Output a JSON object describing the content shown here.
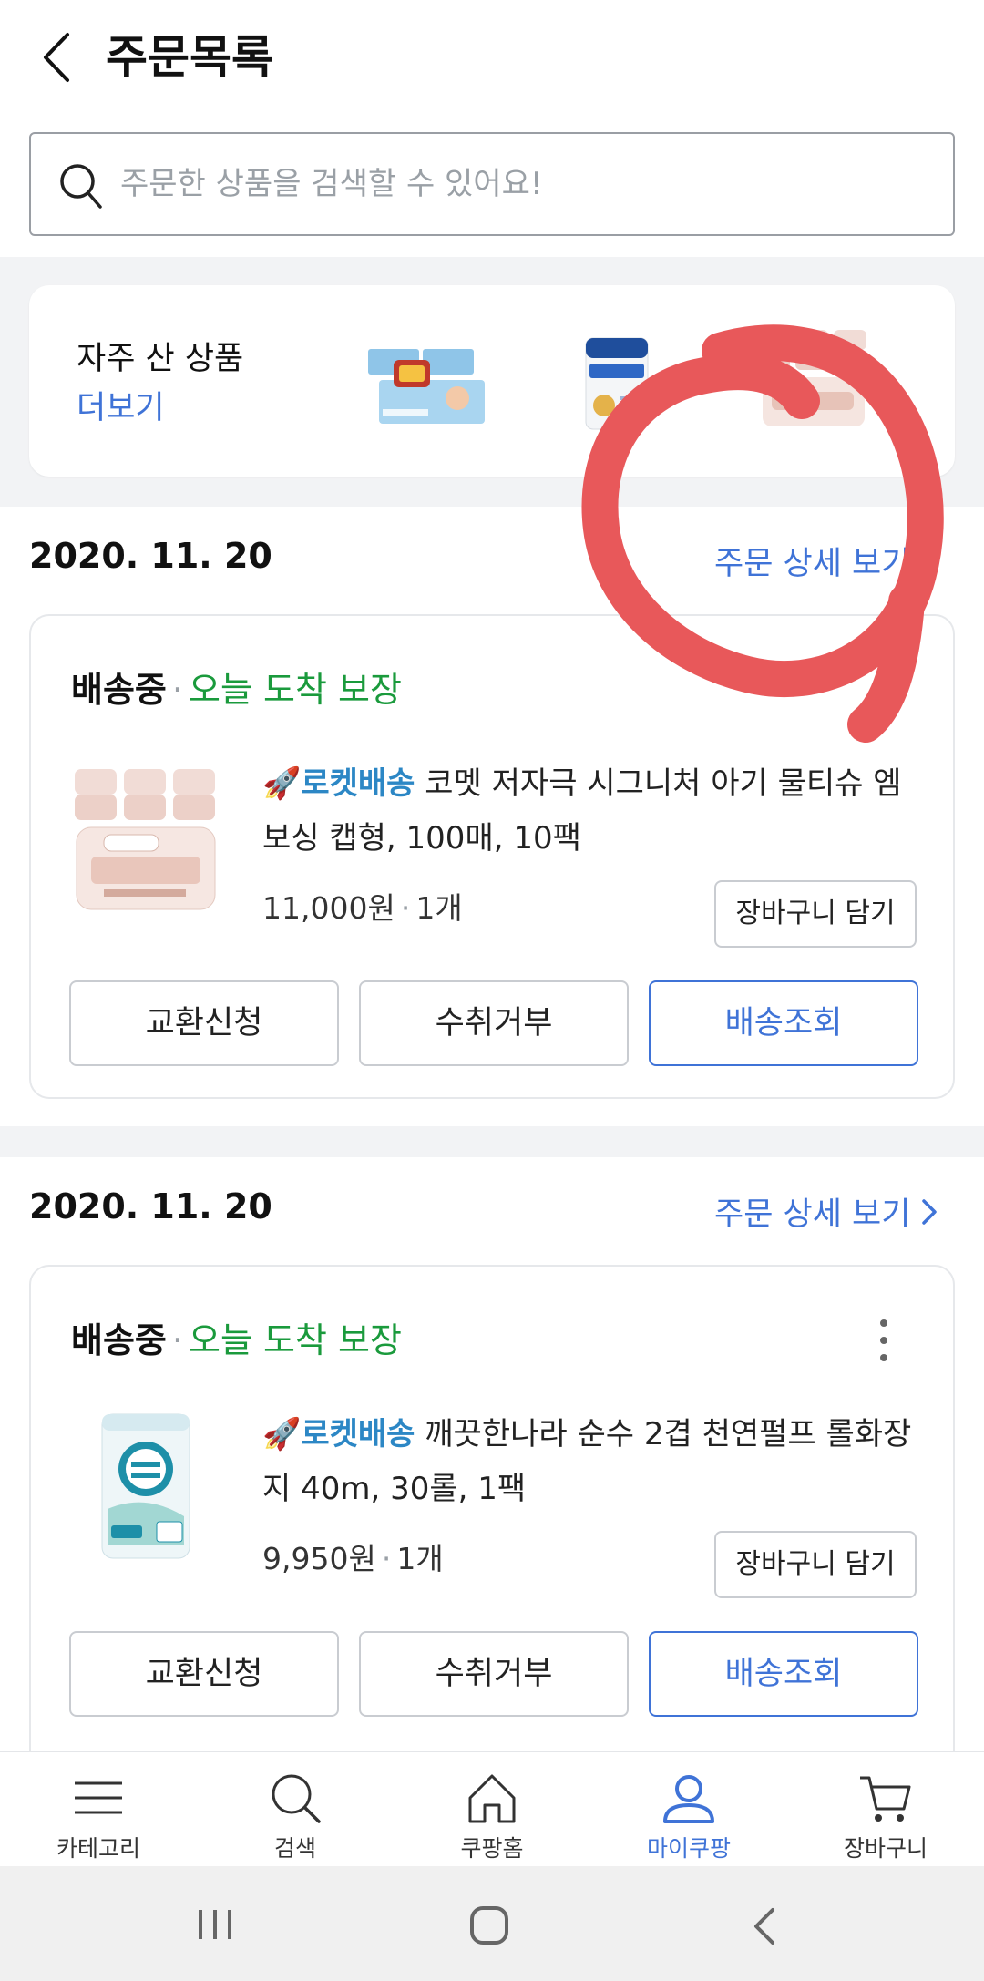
{
  "header": {
    "title": "주문목록",
    "search_placeholder": "주문한 상품을 검색할 수 있어요!"
  },
  "frequent": {
    "title": "자주 산 상품",
    "more": "더보기"
  },
  "orders": [
    {
      "date": "2020. 11. 20",
      "detail_link": "주문 상세 보기",
      "status": "배송중",
      "status_sub": "오늘 도착 보장",
      "rocket": "로켓배송",
      "title": "코멧 저자극 시그니처 아기 물티슈 엠보싱 캡형, 100매, 10팩",
      "price": "11,000원",
      "qty": "1개",
      "cart_button": "장바구니 담기",
      "actions": [
        "교환신청",
        "수취거부",
        "배송조회"
      ]
    },
    {
      "date": "2020. 11. 20",
      "detail_link": "주문 상세 보기",
      "status": "배송중",
      "status_sub": "오늘 도착 보장",
      "rocket": "로켓배송",
      "title": "깨끗한나라 순수 2겹 천연펄프 롤화장지 40m, 30롤, 1팩",
      "price": "9,950원",
      "qty": "1개",
      "cart_button": "장바구니 담기",
      "actions": [
        "교환신청",
        "수취거부",
        "배송조회"
      ]
    }
  ],
  "nav": [
    {
      "label": "카테고리",
      "icon": "menu-icon"
    },
    {
      "label": "검색",
      "icon": "search-icon"
    },
    {
      "label": "쿠팡홈",
      "icon": "home-icon"
    },
    {
      "label": "마이쿠팡",
      "icon": "user-icon",
      "active": true
    },
    {
      "label": "장바구니",
      "icon": "cart-icon"
    }
  ],
  "colors": {
    "accent": "#3f73d7",
    "green": "#1a9a3c",
    "rocket": "#2c87c5",
    "annotation_red": "#e8585a"
  }
}
